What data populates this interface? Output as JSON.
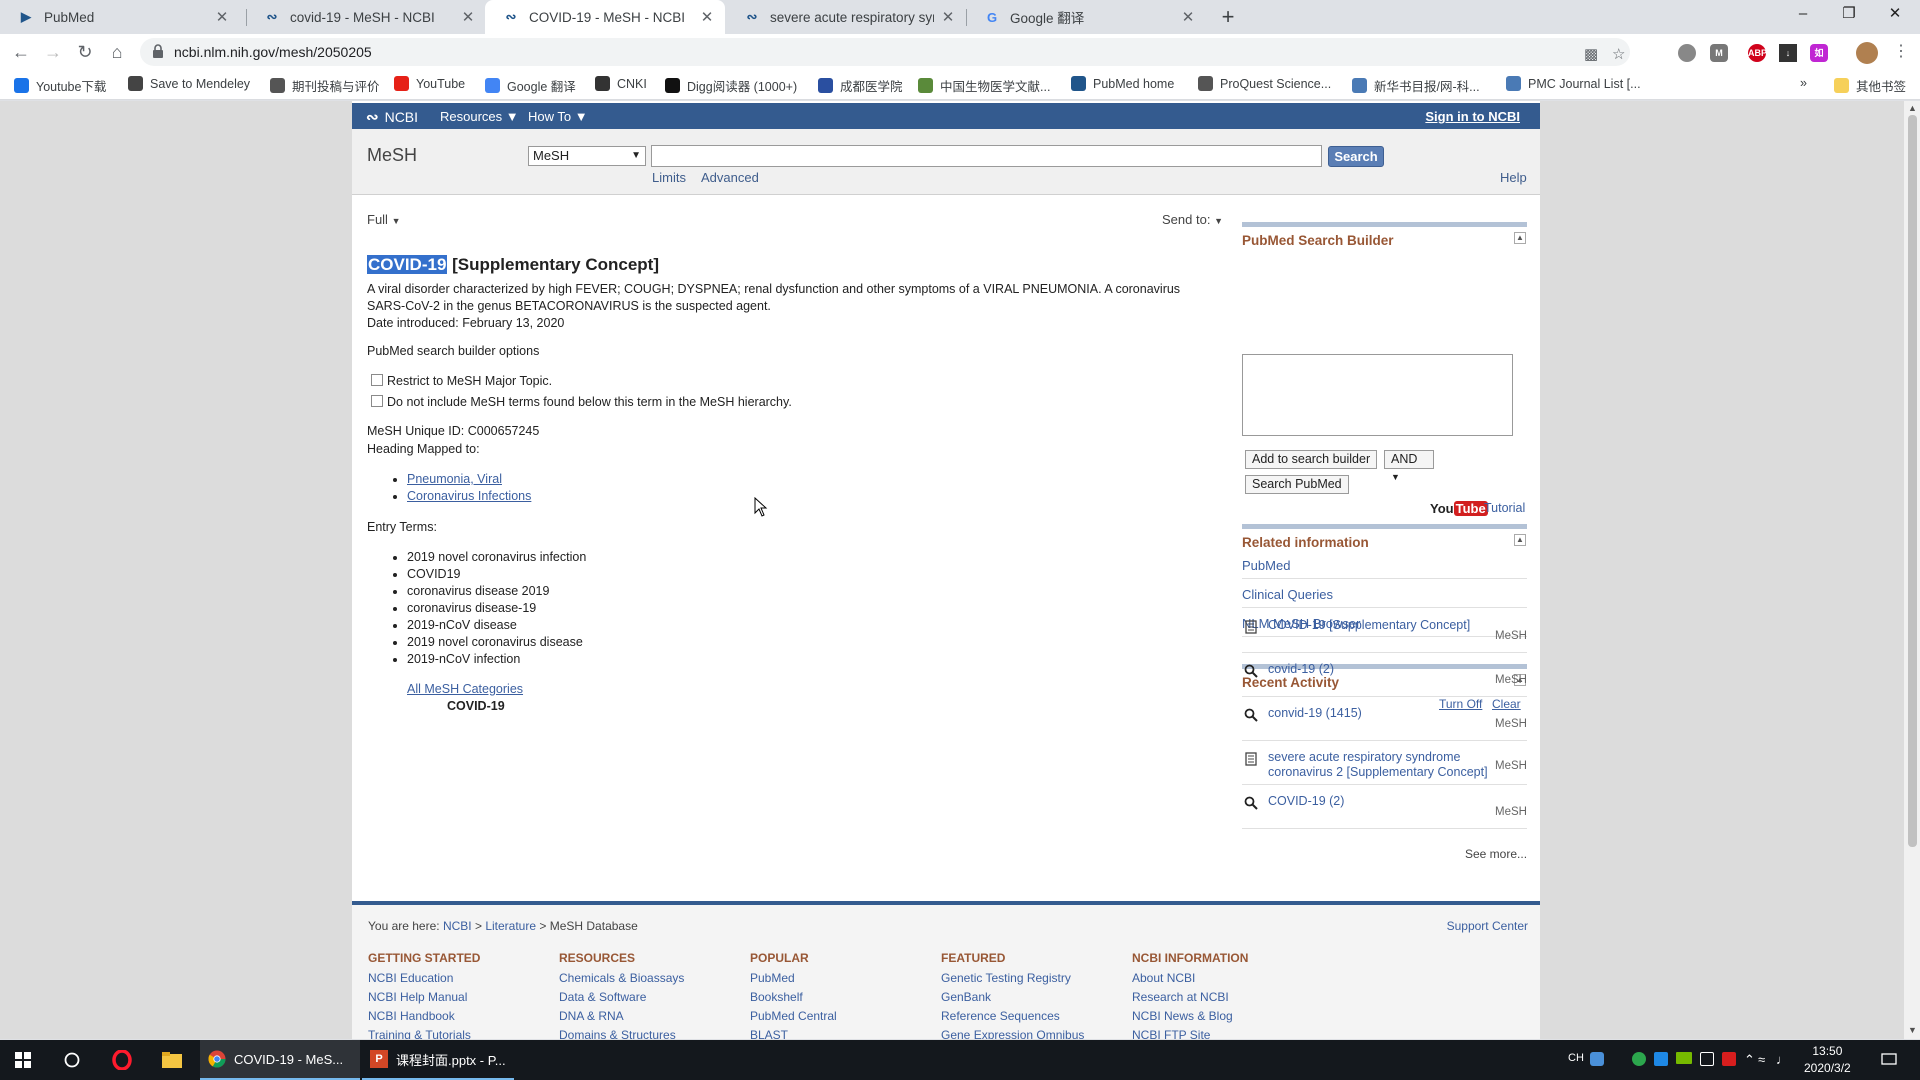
{
  "browser": {
    "tabs": [
      {
        "title": "PubMed",
        "favicon": "pubmed-icon"
      },
      {
        "title": "covid-19 - MeSH - NCBI",
        "favicon": "ncbi-icon"
      },
      {
        "title": "COVID-19 - MeSH - NCBI",
        "favicon": "ncbi-icon",
        "active": true
      },
      {
        "title": "severe acute respiratory syndr",
        "favicon": "ncbi-icon"
      },
      {
        "title": "Google 翻译",
        "favicon": "google-translate-icon"
      }
    ],
    "url": "ncbi.nlm.nih.gov/mesh/2050205",
    "bookmarks": [
      {
        "label": "Youtube下载",
        "icon_color": "#1a73e8"
      },
      {
        "label": "Save to Mendeley",
        "icon_color": "#444444"
      },
      {
        "label": "期刊投稿与评价",
        "icon_color": "#555555"
      },
      {
        "label": "YouTube",
        "icon_color": "#e62117"
      },
      {
        "label": "Google 翻译",
        "icon_color": "#4285f4"
      },
      {
        "label": "CNKI",
        "icon_color": "#333333"
      },
      {
        "label": "Digg阅读器 (1000+)",
        "icon_color": "#111111"
      },
      {
        "label": "成都医学院",
        "icon_color": "#2a4fa0"
      },
      {
        "label": "中国生物医学文献...",
        "icon_color": "#5a8a3a"
      },
      {
        "label": "PubMed home",
        "icon_color": "#20558a"
      },
      {
        "label": "ProQuest Science...",
        "icon_color": "#555555"
      },
      {
        "label": "新华书目报/网-科...",
        "icon_color": "#4a7ab5"
      },
      {
        "label": "PMC Journal List [...",
        "icon_color": "#4a7ab5"
      }
    ],
    "bookmarks_overflow": "»",
    "other_bookmarks": "其他书签"
  },
  "ncbi": {
    "logo": "NCBI",
    "resources": "Resources",
    "howto": "How To",
    "signin": "Sign in to NCBI",
    "db_title": "MeSH",
    "db_select": "MeSH",
    "search_value": "",
    "search_btn": "Search",
    "limits": "Limits",
    "advanced": "Advanced",
    "help": "Help"
  },
  "record": {
    "display": "Full",
    "sendto": "Send to:",
    "title_term": "COVID-19",
    "title_rest": " [Supplementary Concept]",
    "desc1": "A viral disorder characterized by high FEVER; COUGH; DYSPNEA; renal dysfunction and other symptoms of a VIRAL PNEUMONIA. A coronavirus",
    "desc2": "SARS-CoV-2 in the genus BETACORONAVIRUS is the suspected agent.",
    "date_introduced": "Date introduced: February 13, 2020",
    "builder_options": "PubMed search builder options",
    "opt_major": "Restrict to MeSH Major Topic.",
    "opt_noexplode": "Do not include MeSH terms found below this term in the MeSH hierarchy.",
    "unique_id": "MeSH Unique ID: C000657245",
    "heading_mapped": "Heading Mapped to:",
    "mapped": [
      "Pneumonia, Viral",
      "Coronavirus Infections"
    ],
    "entry_terms_label": "Entry Terms:",
    "entry_terms": [
      "2019 novel coronavirus infection",
      "COVID19",
      "coronavirus disease 2019",
      "coronavirus disease-19",
      "2019-nCoV disease",
      "2019 novel coronavirus disease",
      "2019-nCoV infection"
    ],
    "all_categories": "All MeSH Categories",
    "category_term": "COVID-19"
  },
  "sidebar": {
    "builder_title": "PubMed Search Builder",
    "add_btn": "Add to search builder",
    "and_select": "AND",
    "search_pubmed": "Search PubMed",
    "youtube_you": "You",
    "youtube_tube": "Tube",
    "tutorial": "Tutorial",
    "related_title": "Related information",
    "related": [
      "PubMed",
      "Clinical Queries",
      "NLM MeSH Browser"
    ],
    "recent_title": "Recent Activity",
    "turn_off": "Turn Off",
    "clear": "Clear",
    "activity": [
      {
        "type": "doc",
        "text": "COVID-19 [Supplementary Concept]",
        "db": "MeSH"
      },
      {
        "type": "search",
        "text": "covid-19 (2)",
        "db": "MeSH"
      },
      {
        "type": "search",
        "text": "convid-19 (1415)",
        "db": "MeSH"
      },
      {
        "type": "doc",
        "text": "severe acute respiratory syndrome coronavirus 2 [Supplementary Concept]",
        "db": "MeSH"
      },
      {
        "type": "search",
        "text": "COVID-19 (2)",
        "db": "MeSH"
      }
    ],
    "see_more": "See more..."
  },
  "footer": {
    "you_are_here": "You are here:",
    "crumbs": [
      "NCBI",
      "Literature",
      "MeSH Database"
    ],
    "support": "Support Center",
    "columns": [
      {
        "title": "GETTING STARTED",
        "links": [
          "NCBI Education",
          "NCBI Help Manual",
          "NCBI Handbook",
          "Training & Tutorials"
        ]
      },
      {
        "title": "RESOURCES",
        "links": [
          "Chemicals & Bioassays",
          "Data & Software",
          "DNA & RNA",
          "Domains & Structures"
        ]
      },
      {
        "title": "POPULAR",
        "links": [
          "PubMed",
          "Bookshelf",
          "PubMed Central",
          "BLAST"
        ]
      },
      {
        "title": "FEATURED",
        "links": [
          "Genetic Testing Registry",
          "GenBank",
          "Reference Sequences",
          "Gene Expression Omnibus"
        ]
      },
      {
        "title": "NCBI INFORMATION",
        "links": [
          "About NCBI",
          "Research at NCBI",
          "NCBI News & Blog",
          "NCBI FTP Site"
        ]
      }
    ]
  },
  "taskbar": {
    "apps": [
      {
        "label": "COVID-19 - MeS...",
        "icon": "chrome-icon"
      },
      {
        "label": "课程封面.pptx - P...",
        "icon": "powerpoint-icon"
      }
    ],
    "ime": "CH",
    "time": "13:50",
    "date": "2020/3/2"
  }
}
